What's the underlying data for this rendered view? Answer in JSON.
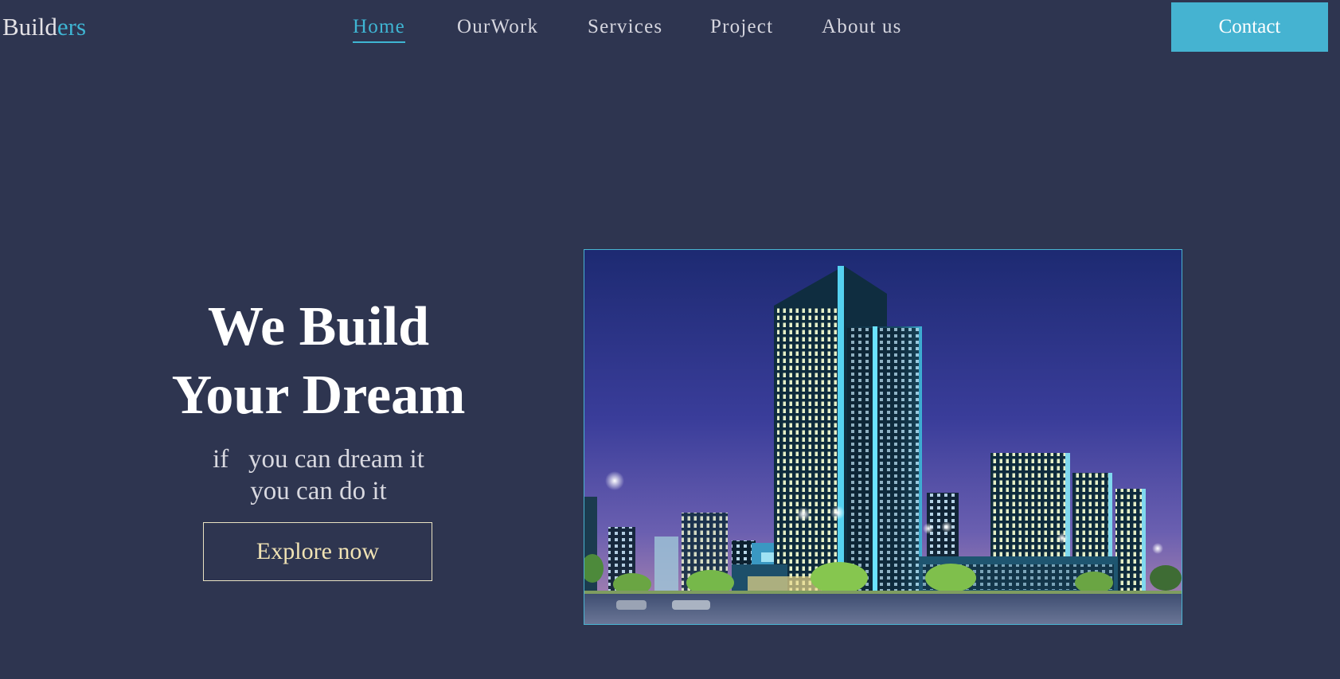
{
  "logo": {
    "part1": "Build",
    "part2": "ers"
  },
  "nav": {
    "items": [
      {
        "label": "Home",
        "active": true
      },
      {
        "label": "OurWork"
      },
      {
        "label": "Services"
      },
      {
        "label": "Project"
      },
      {
        "label": "About us"
      }
    ]
  },
  "header": {
    "contact_label": "Contact"
  },
  "hero": {
    "title_line1": "We Build",
    "title_line2": "Your Dream",
    "subtitle_line1": "if   you can dream it",
    "subtitle_line2": "you can do it",
    "cta_label": "Explore now"
  },
  "colors": {
    "background": "#2e3550",
    "accent": "#45b3d1",
    "cta_text": "#f1e3b4"
  }
}
